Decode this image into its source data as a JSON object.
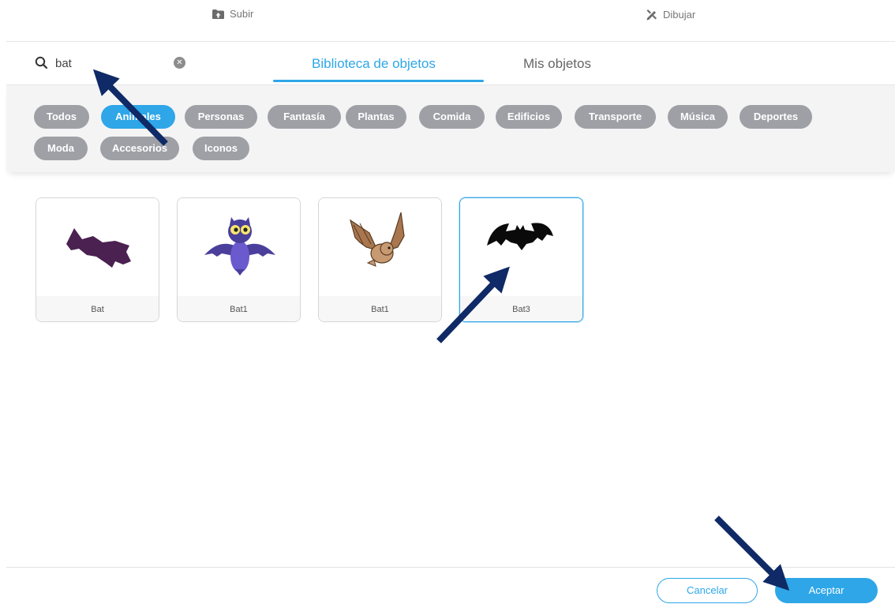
{
  "top_actions": {
    "upload_label": "Subir",
    "draw_label": "Dibujar"
  },
  "search": {
    "value": "bat",
    "placeholder": ""
  },
  "tabs": [
    {
      "label": "Biblioteca de objetos",
      "active": true
    },
    {
      "label": "Mis objetos",
      "active": false
    }
  ],
  "filters": {
    "row1": [
      "Todos",
      "Animales",
      "Personas",
      "Fantasía",
      "Plantas",
      "Comida",
      "Edificios",
      "Transporte",
      "Música",
      "Deportes"
    ],
    "row2": [
      "Moda",
      "Accesorios",
      "Iconos"
    ],
    "active": "Animales"
  },
  "sprites": [
    {
      "name": "Bat",
      "icon": "bat-purple-silhouette-icon"
    },
    {
      "name": "Bat1",
      "icon": "bat-cartoon-blue-icon"
    },
    {
      "name": "Bat1",
      "icon": "bat-brown-icon"
    },
    {
      "name": "Bat3",
      "icon": "bat-black-silhouette-icon",
      "selected": true
    }
  ],
  "buttons": {
    "cancel": "Cancelar",
    "accept": "Aceptar"
  },
  "colors": {
    "accent": "#2ea6e8",
    "chip": "#9ea0a6",
    "annotation_arrow": "#0f2a66"
  }
}
